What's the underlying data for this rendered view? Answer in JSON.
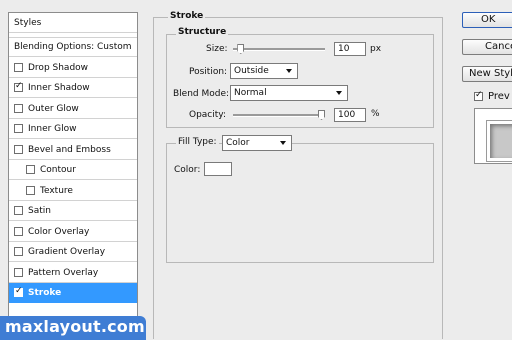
{
  "styles_list": {
    "header": "Styles",
    "blending_options": "Blending Options: Custom",
    "items": [
      {
        "label": "Drop Shadow",
        "checked": false
      },
      {
        "label": "Inner Shadow",
        "checked": true
      },
      {
        "label": "Outer Glow",
        "checked": false
      },
      {
        "label": "Inner Glow",
        "checked": false
      },
      {
        "label": "Bevel and Emboss",
        "checked": false
      },
      {
        "label": "Contour",
        "checked": false
      },
      {
        "label": "Texture",
        "checked": false
      },
      {
        "label": "Satin",
        "checked": false
      },
      {
        "label": "Color Overlay",
        "checked": false
      },
      {
        "label": "Gradient Overlay",
        "checked": false
      },
      {
        "label": "Pattern Overlay",
        "checked": false
      },
      {
        "label": "Stroke",
        "checked": true,
        "selected": true
      }
    ]
  },
  "stroke": {
    "title": "Stroke",
    "structure_title": "Structure",
    "size_label": "Size:",
    "size_value": "10",
    "size_unit": "px",
    "size_slider_level": 0.05,
    "position_label": "Position:",
    "position_value": "Outside",
    "blend_mode_label": "Blend Mode:",
    "blend_mode_value": "Normal",
    "opacity_label": "Opacity:",
    "opacity_value": "100",
    "opacity_unit": "%",
    "opacity_slider_level": 1.0,
    "fill_type_label": "Fill Type:",
    "fill_type_value": "Color",
    "color_label": "Color:",
    "color_value": "#ffffff"
  },
  "buttons": {
    "ok": "OK",
    "cancel": "Cance",
    "new_style": "New Styl",
    "preview_label": "Prev",
    "preview_checked": true
  },
  "watermark": "maxlayout.com"
}
